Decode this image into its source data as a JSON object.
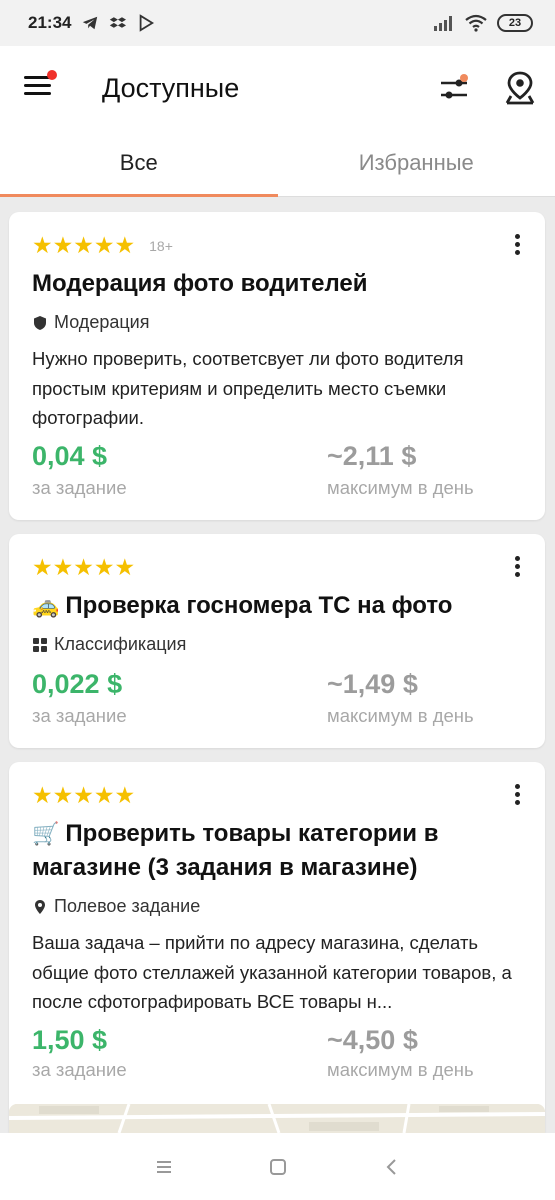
{
  "status_bar": {
    "time": "21:34",
    "battery": "23"
  },
  "app_bar": {
    "title": "Доступные"
  },
  "tabs": [
    {
      "label": "Все",
      "active": true
    },
    {
      "label": "Избранные",
      "active": false
    }
  ],
  "cards": [
    {
      "rating_stars": 5,
      "age_badge": "18+",
      "title": "Модерация фото водителей",
      "title_emoji": "",
      "category": "Модерация",
      "category_icon": "shield-icon",
      "description": "Нужно проверить, соответсвует ли фото водителя простым критериям и определить место съемки фотографии.",
      "price": "0,04 $",
      "price_label": "за задание",
      "max_price": "~2,11 $",
      "max_label": "максимум в день"
    },
    {
      "rating_stars": 5,
      "age_badge": "",
      "title": "Проверка госномера ТС на фото",
      "title_emoji": "🚕",
      "category": "Классификация",
      "category_icon": "grid-icon",
      "description": "",
      "price": "0,022 $",
      "price_label": "за задание",
      "max_price": "~1,49 $",
      "max_label": "максимум в день"
    },
    {
      "rating_stars": 5,
      "age_badge": "",
      "title": "Проверить товары категории в магазине (3 задания в магазине)",
      "title_emoji": "🛒",
      "category": "Полевое задание",
      "category_icon": "location-pin-icon",
      "description": "Ваша задача – прийти по адресу магазина, сделать общие фото стеллажей указанной категории товаров, а после сфотографировать ВСЕ товары н...",
      "price": "1,50 $",
      "price_label": "за задание",
      "max_price": "~4,50 $",
      "max_label": "максимум в день"
    }
  ],
  "colors": {
    "accent": "#f08a5d",
    "star": "#f5c000",
    "price_green": "#3cb56a",
    "notification_dot": "#f0302a"
  }
}
